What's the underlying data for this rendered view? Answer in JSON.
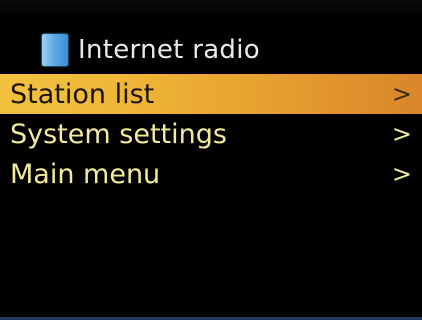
{
  "header": {
    "title": "Internet radio",
    "icon": "app-icon"
  },
  "menu": {
    "items": [
      {
        "label": "Station list",
        "chevron": ">",
        "selected": true
      },
      {
        "label": "System settings",
        "chevron": ">",
        "selected": false
      },
      {
        "label": "Main menu",
        "chevron": ">",
        "selected": false
      }
    ]
  },
  "colors": {
    "background": "#000000",
    "selected_row": "#efb638",
    "menu_text": "#f3eb9c",
    "title_text": "#e8eaee"
  }
}
